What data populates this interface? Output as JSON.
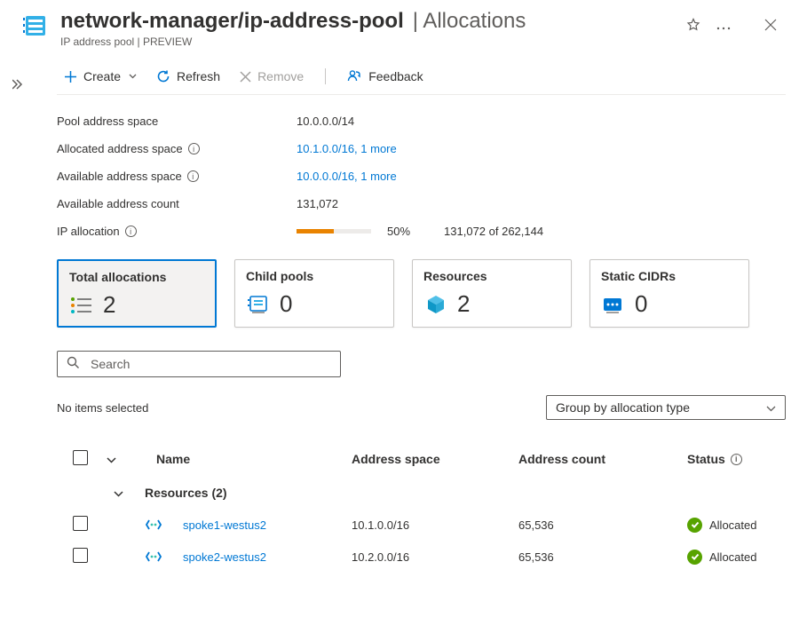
{
  "header": {
    "title": "network-manager/ip-address-pool",
    "section": "Allocations",
    "subtitle": "IP address pool | PREVIEW"
  },
  "toolbar": {
    "create": "Create",
    "refresh": "Refresh",
    "remove": "Remove",
    "feedback": "Feedback"
  },
  "props": {
    "pool_space_label": "Pool address space",
    "pool_space_value": "10.0.0.0/14",
    "allocated_label": "Allocated address space",
    "allocated_value": "10.1.0.0/16, 1 more",
    "available_label": "Available address space",
    "available_value": "10.0.0.0/16, 1 more",
    "avail_count_label": "Available address count",
    "avail_count_value": "131,072",
    "ip_alloc_label": "IP allocation",
    "ip_alloc_percent": "50%",
    "ip_alloc_detail": "131,072 of 262,144"
  },
  "cards": {
    "total": {
      "title": "Total allocations",
      "value": "2"
    },
    "child": {
      "title": "Child pools",
      "value": "0"
    },
    "resources": {
      "title": "Resources",
      "value": "2"
    },
    "static": {
      "title": "Static CIDRs",
      "value": "0"
    }
  },
  "search": {
    "placeholder": "Search"
  },
  "selection_text": "No items selected",
  "group_by": "Group by allocation type",
  "columns": {
    "name": "Name",
    "address_space": "Address space",
    "address_count": "Address count",
    "status": "Status"
  },
  "group_label": "Resources (2)",
  "rows": [
    {
      "name": "spoke1-westus2",
      "space": "10.1.0.0/16",
      "count": "65,536",
      "status": "Allocated"
    },
    {
      "name": "spoke2-westus2",
      "space": "10.2.0.0/16",
      "count": "65,536",
      "status": "Allocated"
    }
  ]
}
